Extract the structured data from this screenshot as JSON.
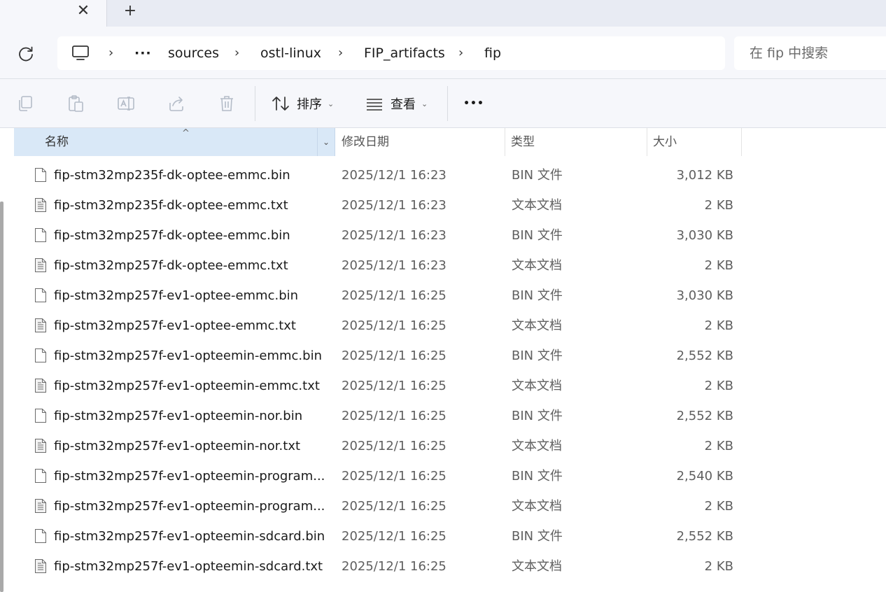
{
  "tabs": {
    "close_glyph": "✕",
    "new_glyph": "+"
  },
  "address": {
    "overflow": "···",
    "sep": "›",
    "crumbs": [
      "sources",
      "ostl-linux",
      "FIP_artifacts",
      "fip"
    ]
  },
  "search": {
    "placeholder": "在 fip 中搜索"
  },
  "toolbar": {
    "sort_label": "排序",
    "view_label": "查看",
    "more_label": "•••",
    "caret": "⌄"
  },
  "columns": {
    "name": "名称",
    "date": "修改日期",
    "type": "类型",
    "size": "大小",
    "sort_glyph": "^",
    "dropdown_glyph": "⌄"
  },
  "files": [
    {
      "name": "fip-stm32mp235f-dk-optee-emmc.bin",
      "date": "2025/12/1 16:23",
      "type": "BIN 文件",
      "size": "3,012 KB",
      "icon": "bin-file-icon"
    },
    {
      "name": "fip-stm32mp235f-dk-optee-emmc.txt",
      "date": "2025/12/1 16:23",
      "type": "文本文档",
      "size": "2 KB",
      "icon": "text-file-icon"
    },
    {
      "name": "fip-stm32mp257f-dk-optee-emmc.bin",
      "date": "2025/12/1 16:23",
      "type": "BIN 文件",
      "size": "3,030 KB",
      "icon": "bin-file-icon"
    },
    {
      "name": "fip-stm32mp257f-dk-optee-emmc.txt",
      "date": "2025/12/1 16:23",
      "type": "文本文档",
      "size": "2 KB",
      "icon": "text-file-icon"
    },
    {
      "name": "fip-stm32mp257f-ev1-optee-emmc.bin",
      "date": "2025/12/1 16:25",
      "type": "BIN 文件",
      "size": "3,030 KB",
      "icon": "bin-file-icon"
    },
    {
      "name": "fip-stm32mp257f-ev1-optee-emmc.txt",
      "date": "2025/12/1 16:25",
      "type": "文本文档",
      "size": "2 KB",
      "icon": "text-file-icon"
    },
    {
      "name": "fip-stm32mp257f-ev1-opteemin-emmc.bin",
      "date": "2025/12/1 16:25",
      "type": "BIN 文件",
      "size": "2,552 KB",
      "icon": "bin-file-icon"
    },
    {
      "name": "fip-stm32mp257f-ev1-opteemin-emmc.txt",
      "date": "2025/12/1 16:25",
      "type": "文本文档",
      "size": "2 KB",
      "icon": "text-file-icon"
    },
    {
      "name": "fip-stm32mp257f-ev1-opteemin-nor.bin",
      "date": "2025/12/1 16:25",
      "type": "BIN 文件",
      "size": "2,552 KB",
      "icon": "bin-file-icon"
    },
    {
      "name": "fip-stm32mp257f-ev1-opteemin-nor.txt",
      "date": "2025/12/1 16:25",
      "type": "文本文档",
      "size": "2 KB",
      "icon": "text-file-icon"
    },
    {
      "name": "fip-stm32mp257f-ev1-opteemin-program...",
      "date": "2025/12/1 16:25",
      "type": "BIN 文件",
      "size": "2,540 KB",
      "icon": "bin-file-icon"
    },
    {
      "name": "fip-stm32mp257f-ev1-opteemin-program...",
      "date": "2025/12/1 16:25",
      "type": "文本文档",
      "size": "2 KB",
      "icon": "text-file-icon"
    },
    {
      "name": "fip-stm32mp257f-ev1-opteemin-sdcard.bin",
      "date": "2025/12/1 16:25",
      "type": "BIN 文件",
      "size": "2,552 KB",
      "icon": "bin-file-icon"
    },
    {
      "name": "fip-stm32mp257f-ev1-opteemin-sdcard.txt",
      "date": "2025/12/1 16:25",
      "type": "文本文档",
      "size": "2 KB",
      "icon": "text-file-icon"
    }
  ]
}
